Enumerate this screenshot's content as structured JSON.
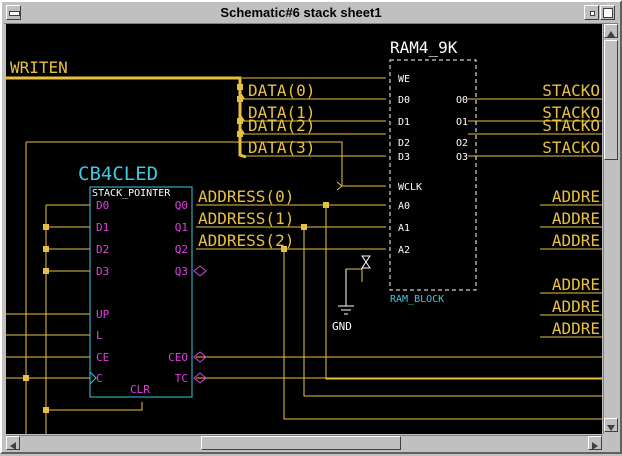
{
  "window": {
    "title": "Schematic#6 stack sheet1"
  },
  "colors": {
    "wire": "#e8c040",
    "symbol": "#ffffff",
    "cb4_body": "#40c8e0",
    "pin_label": "#e040e0",
    "net_label": "#e8c040",
    "junction": "#e8c040",
    "title_text": "#000000"
  },
  "schematic": {
    "top_left_net": "WRITEN",
    "ram": {
      "type": "RAM4_9K",
      "instance": "RAM_BLOCK",
      "left_pins": [
        "WE",
        "D0",
        "D1",
        "D2",
        "D3",
        "WCLK",
        "A0",
        "A1",
        "A2"
      ],
      "right_pins": [
        "O0",
        "O1",
        "O2",
        "O3"
      ]
    },
    "data_nets": [
      "DATA(0)",
      "DATA(1)",
      "DATA(2)",
      "DATA(3)"
    ],
    "address_nets": [
      "ADDRESS(0)",
      "ADDRESS(1)",
      "ADDRESS(2)"
    ],
    "stack_outputs": [
      "STACKO",
      "STACKO",
      "STACKO",
      "STACKO"
    ],
    "right_address_labels": [
      "ADDRE",
      "ADDRE",
      "ADDRE",
      "ADDRE",
      "ADDRE",
      "ADDRE"
    ],
    "gnd_label": "GND",
    "counter": {
      "type": "CB4CLED",
      "instance": "STACK_POINTER",
      "left_pins": [
        "D0",
        "D1",
        "D2",
        "D3",
        "UP",
        "L",
        "CE",
        "C"
      ],
      "right_pins": [
        "Q0",
        "Q1",
        "Q2",
        "Q3",
        "CEO",
        "TC"
      ],
      "bottom_pin": "CLR"
    }
  }
}
